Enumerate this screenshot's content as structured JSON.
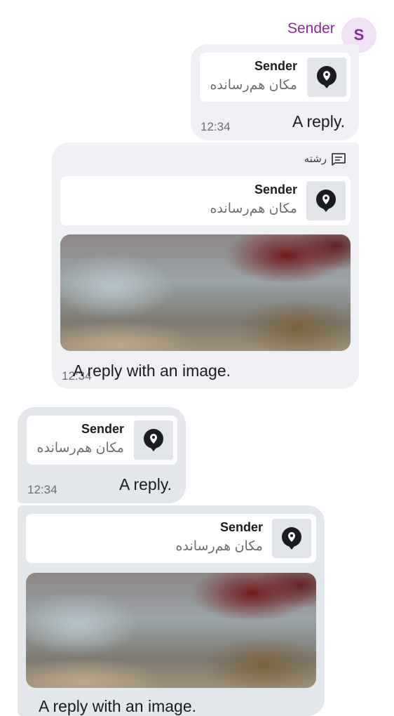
{
  "header": {
    "sender_name": "Sender",
    "avatar_initial": "S"
  },
  "messages": [
    {
      "reply_sender": "Sender",
      "reply_location": "مکان هم‌رسانده",
      "text": "A reply.",
      "time": "12:34"
    },
    {
      "thread_label": "رشته",
      "reply_sender": "Sender",
      "reply_location": "مکان هم‌رسانده",
      "text": "A reply with an image.",
      "time": "12:34"
    },
    {
      "reply_sender": "Sender",
      "reply_location": "مکان هم‌رسانده",
      "text": "A reply.",
      "time": "12:34"
    },
    {
      "reply_sender": "Sender",
      "reply_location": "مکان هم‌رسانده",
      "text": "A reply with an image."
    }
  ],
  "colors": {
    "accent": "#8a2b99",
    "avatar_bg": "#f1e1f6",
    "bubble_light": "#eff0f4",
    "bubble_dark": "#e3e6eb"
  },
  "icons": {
    "location": "map-pin-icon",
    "thread": "thread-icon"
  }
}
